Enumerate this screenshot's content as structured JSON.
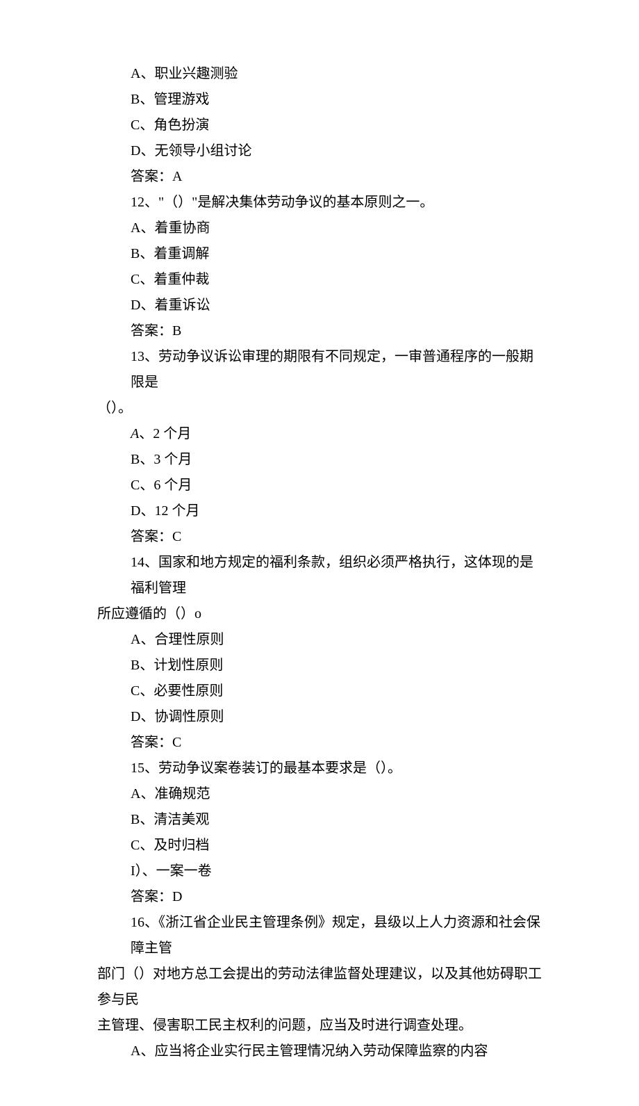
{
  "q11": {
    "optA": "A、职业兴趣测验",
    "optB": "B、管理游戏",
    "optC": "C、角色扮演",
    "optD": "D、无领导小组讨论",
    "answer": "答案：A"
  },
  "q12": {
    "stem": "12、\"（）\"是解决集体劳动争议的基本原则之一。",
    "optA": "A、着重协商",
    "optB": "B、着重调解",
    "optC": "C、着重仲裁",
    "optD": "D、着重诉讼",
    "answer": "答案：B"
  },
  "q13": {
    "stem1": "13、劳动争议诉讼审理的期限有不同规定，一审普通程序的一般期限是",
    "stem2": "（）。",
    "optA_label": "A",
    "optA_text": "、2 个月",
    "optB": "B、3 个月",
    "optC": "C、6 个月",
    "optD": "D、12 个月",
    "answer": "答案：C"
  },
  "q14": {
    "stem1": "14、国家和地方规定的福利条款，组织必须严格执行，这体现的是福利管理",
    "stem2": "所应遵循的（）o",
    "optA": "A、合理性原则",
    "optB": "B、计划性原则",
    "optC": "C、必要性原则",
    "optD": "D、协调性原则",
    "answer": "答案：C"
  },
  "q15": {
    "stem": "15、劳动争议案卷装订的最基本要求是（）。",
    "optA": "A、准确规范",
    "optB": "B、清洁美观",
    "optC": "C、及时归档",
    "optD": "I）、一案一卷",
    "answer": "答案：D"
  },
  "q16": {
    "stem1": "16、《浙江省企业民主管理条例》规定，县级以上人力资源和社会保障主管",
    "stem2": "部门（）对地方总工会提出的劳动法律监督处理建议，以及其他妨碍职工参与民",
    "stem3": "主管理、侵害职工民主权利的问题，应当及时进行调查处理。",
    "optA": "A、应当将企业实行民主管理情况纳入劳动保障监察的内容"
  }
}
